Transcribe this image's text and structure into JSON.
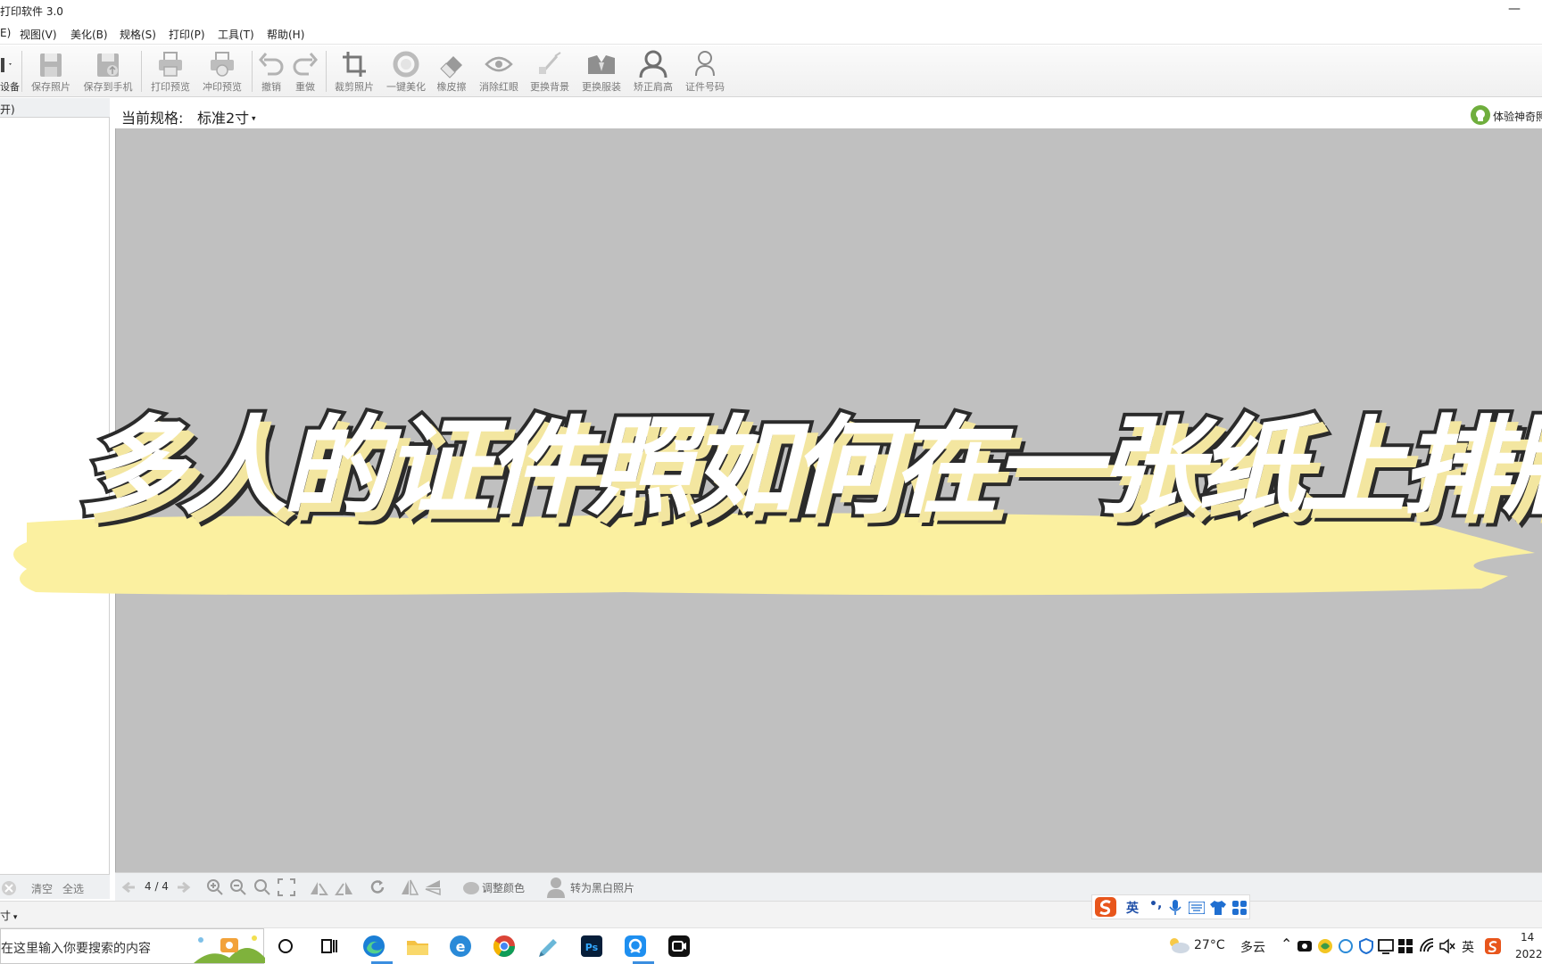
{
  "window": {
    "title": "打印软件 3.0",
    "minimize_glyph": "—"
  },
  "menu": [
    {
      "label": "E)"
    },
    {
      "label": "视图(V)"
    },
    {
      "label": "美化(B)"
    },
    {
      "label": "规格(S)"
    },
    {
      "label": "打印(P)"
    },
    {
      "label": "工具(T)"
    },
    {
      "label": "帮助(H)"
    }
  ],
  "toolbar": {
    "device_label": "设备",
    "buttons": [
      {
        "label": "保存照片",
        "icon": "save-icon"
      },
      {
        "label": "保存到手机",
        "icon": "save-to-phone-icon"
      },
      {
        "label": "打印预览",
        "icon": "printer-icon"
      },
      {
        "label": "冲印预览",
        "icon": "photo-print-icon"
      },
      {
        "label": "撤销",
        "icon": "undo-icon"
      },
      {
        "label": "重做",
        "icon": "redo-icon"
      },
      {
        "label": "裁剪照片",
        "icon": "crop-icon"
      },
      {
        "label": "一键美化",
        "icon": "beautify-icon"
      },
      {
        "label": "橡皮擦",
        "icon": "eraser-icon"
      },
      {
        "label": "消除红眼",
        "icon": "eye-icon"
      },
      {
        "label": "更换背景",
        "icon": "brush-icon"
      },
      {
        "label": "更换服装",
        "icon": "suit-icon"
      },
      {
        "label": "矫正肩高",
        "icon": "shoulder-icon"
      },
      {
        "label": "证件号码",
        "icon": "person-id-icon"
      }
    ]
  },
  "left_panel": {
    "header": "开)",
    "clear_label": "清空",
    "select_all_label": "全选",
    "size_label": "寸"
  },
  "main": {
    "spec_label": "当前规格:",
    "spec_value": "标准2寸",
    "promo_label": "体验神奇照"
  },
  "bottom_bar": {
    "page_indicator": "4 / 4",
    "adjust_color_label": "调整颜色",
    "to_bw_label": "转为黑白照片"
  },
  "overlay": {
    "headline": "多人的证件照如何在一张纸上排版",
    "banner_color": "#fbf0a0"
  },
  "ime": {
    "lang": "英",
    "punct": "•,",
    "brand_color": "#e8561c"
  },
  "taskbar": {
    "search_placeholder": "在这里输入你要搜索的内容",
    "weather_temp": "27°C",
    "weather_desc": "多云",
    "ime_lang": "英",
    "clock_time": "14",
    "clock_date": "2022"
  },
  "colors": {
    "canvas_bg": "#c0c0c0",
    "toolbar_text": "#7a7a7a",
    "promo_green": "#6fae3d"
  }
}
